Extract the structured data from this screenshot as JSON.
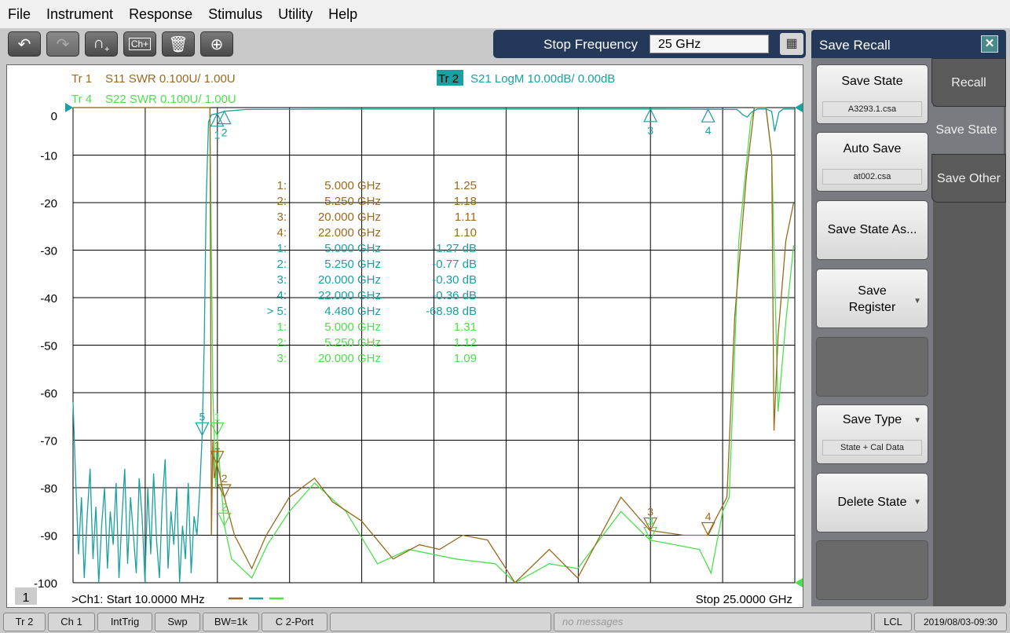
{
  "menu": [
    "File",
    "Instrument",
    "Response",
    "Stimulus",
    "Utility",
    "Help"
  ],
  "toolbar": {
    "icons": [
      "undo-icon",
      "redo-icon",
      "add-trace-icon",
      "add-channel-icon",
      "delete-icon",
      "zoom-icon"
    ]
  },
  "entry": {
    "label": "Stop Frequency",
    "value": "25 GHz",
    "keypad_icon": "keypad-icon"
  },
  "traces_header": [
    {
      "id": "Tr  1",
      "desc": "S11 SWR 0.100U/  1.00U",
      "color": "#9a6a1e"
    },
    {
      "id": "Tr  2",
      "desc": "S21 LogM 10.00dB/  0.00dB",
      "color": "#1aa0a0",
      "active": true
    },
    {
      "id": "Tr  4",
      "desc": "S22 SWR 0.100U/  1.00U",
      "color": "#4de04d"
    }
  ],
  "channel": {
    "number": "1",
    "start": ">Ch1:  Start  10.0000 MHz",
    "stop": "Stop  25.0000 GHz"
  },
  "marker_table": [
    {
      "n": "1:",
      "f": "5.000  GHz",
      "v": "1.25",
      "color": "#9a6a1e"
    },
    {
      "n": "2:",
      "f": "5.250  GHz",
      "v": "1.18",
      "color": "#9a6a1e"
    },
    {
      "n": "3:",
      "f": "20.000  GHz",
      "v": "1.11",
      "color": "#9a6a1e"
    },
    {
      "n": "4:",
      "f": "22.000  GHz",
      "v": "1.10",
      "color": "#9a6a1e"
    },
    {
      "n": "1:",
      "f": "5.000  GHz",
      "v": "-1.27 dB",
      "color": "#1aa0a0"
    },
    {
      "n": "2:",
      "f": "5.250  GHz",
      "v": "-0.77 dB",
      "color": "#1aa0a0"
    },
    {
      "n": "3:",
      "f": "20.000  GHz",
      "v": "-0.30 dB",
      "color": "#1aa0a0"
    },
    {
      "n": "4:",
      "f": "22.000  GHz",
      "v": "-0.36 dB",
      "color": "#1aa0a0"
    },
    {
      "n": "> 5:",
      "f": "4.480  GHz",
      "v": "-68.98 dB",
      "color": "#1aa0a0"
    },
    {
      "n": "1:",
      "f": "5.000  GHz",
      "v": "1.31",
      "color": "#4de04d"
    },
    {
      "n": "2:",
      "f": "5.250  GHz",
      "v": "1.12",
      "color": "#4de04d"
    },
    {
      "n": "3:",
      "f": "20.000  GHz",
      "v": "1.09",
      "color": "#4de04d"
    }
  ],
  "chart_data": {
    "type": "line",
    "xlim": [
      0.01,
      25
    ],
    "x_unit": "GHz",
    "ylim": [
      -100,
      0
    ],
    "yticks": [
      "0",
      "-10",
      "-20",
      "-30",
      "-40",
      "-50",
      "-60",
      "-70",
      "-80",
      "-90",
      "-100"
    ],
    "grid": true,
    "series": [
      {
        "name": "S21",
        "unit": "dB",
        "color": "#1aa0a0",
        "x": [
          0.01,
          0.1,
          0.2,
          0.3,
          0.4,
          0.5,
          0.6,
          0.7,
          0.8,
          0.9,
          1.0,
          1.1,
          1.2,
          1.3,
          1.4,
          1.5,
          1.6,
          1.7,
          1.8,
          1.9,
          2.0,
          2.1,
          2.2,
          2.3,
          2.4,
          2.5,
          2.6,
          2.7,
          2.8,
          2.9,
          3.0,
          3.1,
          3.2,
          3.3,
          3.4,
          3.5,
          3.6,
          3.7,
          3.8,
          3.9,
          4.0,
          4.1,
          4.2,
          4.3,
          4.4,
          4.48,
          4.55,
          4.62,
          4.7,
          4.8,
          5.0,
          5.25,
          6,
          10,
          15,
          20,
          22,
          23,
          23.2,
          23.35,
          23.5,
          23.7,
          24,
          24.2,
          24.3,
          24.45,
          24.6,
          25
        ],
        "y": [
          -62,
          -78,
          -94,
          -82,
          -99,
          -86,
          -76,
          -95,
          -84,
          -100,
          -88,
          -80,
          -97,
          -85,
          -92,
          -79,
          -99,
          -87,
          -76,
          -96,
          -82,
          -90,
          -98,
          -78,
          -86,
          -100,
          -80,
          -94,
          -77,
          -91,
          -99,
          -83,
          -74,
          -97,
          -85,
          -92,
          -80,
          -100,
          -88,
          -95,
          -79,
          -98,
          -86,
          -90,
          -80,
          -68.98,
          -50,
          -20,
          -3,
          -1.5,
          -1.27,
          -0.77,
          -0.4,
          -0.3,
          -0.3,
          -0.3,
          -0.36,
          -0.4,
          -1.5,
          -2,
          -1,
          -0.3,
          -0.3,
          -0.8,
          -5,
          -1,
          -0.3,
          -0.3
        ]
      },
      {
        "name": "S11",
        "unit": "U",
        "color": "#9a6a1e",
        "x": [
          0.01,
          4.75,
          4.8,
          4.85,
          4.9,
          5.0,
          5.25,
          5.6,
          6.2,
          6.7,
          7.5,
          8.37,
          9.0,
          10.0,
          11.09,
          12.0,
          12.7,
          13.5,
          14.36,
          15.31,
          16.5,
          17.48,
          18.98,
          19.98,
          21.15,
          21.97,
          22.65,
          22.92,
          23.33,
          23.6,
          24.0,
          24.2,
          24.28,
          24.42,
          24.69,
          24.96
        ],
        "y": [
          2.5,
          2.5,
          1.1,
          1.3,
          1.22,
          1.25,
          1.18,
          1.1,
          1.03,
          1.1,
          1.18,
          1.22,
          1.17,
          1.13,
          1.05,
          1.08,
          1.07,
          1.1,
          1.09,
          1.0,
          1.07,
          1.01,
          1.18,
          1.11,
          1.1,
          1.1,
          1.18,
          1.56,
          1.86,
          2.05,
          2.05,
          1.9,
          1.32,
          1.52,
          1.72,
          1.8
        ]
      },
      {
        "name": "S22",
        "unit": "U",
        "color": "#4de04d",
        "x": [
          0.01,
          4.75,
          4.85,
          4.95,
          5.0,
          5.25,
          5.5,
          6.2,
          6.74,
          7.5,
          8.37,
          9.46,
          10.55,
          11.64,
          13.27,
          14.63,
          15.31,
          16.5,
          17.48,
          18.98,
          19.98,
          21.7,
          22.1,
          22.5,
          22.73,
          23.06,
          23.47,
          23.6,
          24.0,
          24.2,
          24.42,
          24.69,
          24.96
        ],
        "y": [
          2.5,
          2.5,
          1.4,
          1.2,
          1.31,
          1.12,
          1.05,
          1.01,
          1.08,
          1.15,
          1.21,
          1.15,
          1.04,
          1.07,
          1.05,
          1.04,
          1.0,
          1.04,
          1.03,
          1.15,
          1.09,
          1.07,
          1.02,
          1.15,
          1.18,
          1.72,
          1.97,
          2.05,
          2.05,
          1.9,
          1.36,
          1.55,
          1.71
        ]
      }
    ],
    "markers": [
      {
        "trace": "S21",
        "label": "1",
        "x": 5.0,
        "y": -1.27
      },
      {
        "trace": "S21",
        "label": "2",
        "x": 5.25,
        "y": -0.77
      },
      {
        "trace": "S21",
        "label": "3",
        "x": 20.0,
        "y": -0.3
      },
      {
        "trace": "S21",
        "label": "4",
        "x": 22.0,
        "y": -0.36
      },
      {
        "trace": "S21",
        "label": "5",
        "x": 4.48,
        "y": -68.98
      },
      {
        "trace": "S11",
        "label": "1",
        "x": 5.0,
        "y": 1.25
      },
      {
        "trace": "S11",
        "label": "2",
        "x": 5.25,
        "y": 1.18
      },
      {
        "trace": "S11",
        "label": "3",
        "x": 20.0,
        "y": 1.11
      },
      {
        "trace": "S11",
        "label": "4",
        "x": 22.0,
        "y": 1.1
      },
      {
        "trace": "S22",
        "label": "1",
        "x": 5.0,
        "y": 1.31
      },
      {
        "trace": "S22",
        "label": "2",
        "x": 5.25,
        "y": 1.12
      },
      {
        "trace": "S22",
        "label": "3",
        "x": 20.0,
        "y": 1.09
      }
    ]
  },
  "panel": {
    "title": "Save Recall",
    "buttons": [
      {
        "label": "Save State",
        "sub": "A3293.1.csa"
      },
      {
        "label": "Auto Save",
        "sub": "at002.csa"
      },
      {
        "label": "Save State As..."
      },
      {
        "label": "Save\nRegister"
      },
      {
        "label": ""
      },
      {
        "label": "Save Type",
        "sub": "State + Cal Data"
      },
      {
        "label": "Delete State"
      },
      {
        "label": ""
      }
    ],
    "tabs": [
      "Recall",
      "Save State",
      "Save Other"
    ]
  },
  "status": [
    "Tr 2",
    "Ch 1",
    "IntTrig",
    "Swp",
    "BW=1k",
    "C  2-Port",
    "",
    "no messages",
    "LCL",
    "2019/08/03-09:30"
  ]
}
